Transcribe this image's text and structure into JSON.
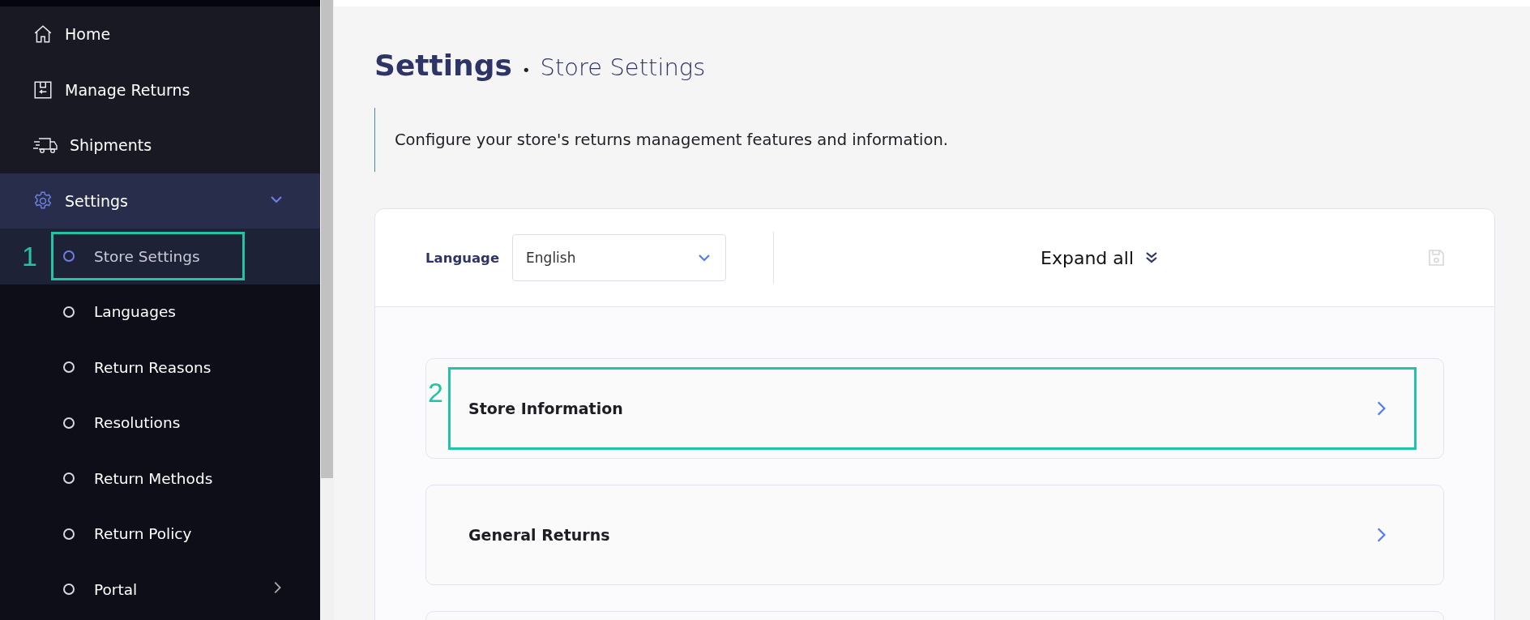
{
  "sidebar": {
    "items": [
      {
        "label": "Home",
        "kind": "link",
        "selected": false
      },
      {
        "label": "Manage Returns",
        "kind": "link",
        "selected": false
      },
      {
        "label": "Shipments",
        "kind": "link",
        "selected": false
      },
      {
        "label": "Settings",
        "kind": "group",
        "selected": true,
        "expanded": true,
        "children": [
          {
            "label": "Store Settings",
            "kind": "link",
            "selected": true,
            "annotation": "1"
          },
          {
            "label": "Languages",
            "kind": "link",
            "selected": false
          },
          {
            "label": "Return Reasons",
            "kind": "link",
            "selected": false
          },
          {
            "label": "Resolutions",
            "kind": "link",
            "selected": false
          },
          {
            "label": "Return Methods",
            "kind": "link",
            "selected": false
          },
          {
            "label": "Return Policy",
            "kind": "link",
            "selected": false
          },
          {
            "label": "Portal",
            "kind": "group",
            "selected": false,
            "expanded": false
          }
        ]
      }
    ]
  },
  "page": {
    "title": "Settings",
    "separator": "•",
    "subtitle": "Store Settings",
    "description": "Configure your store's returns management features and information."
  },
  "toolbar": {
    "language_label": "Language",
    "language_value": "English",
    "expand_all": "Expand all",
    "save_disabled": true
  },
  "sections": [
    {
      "title": "Store Information",
      "annotation": "2"
    },
    {
      "title": "General Returns"
    }
  ]
}
